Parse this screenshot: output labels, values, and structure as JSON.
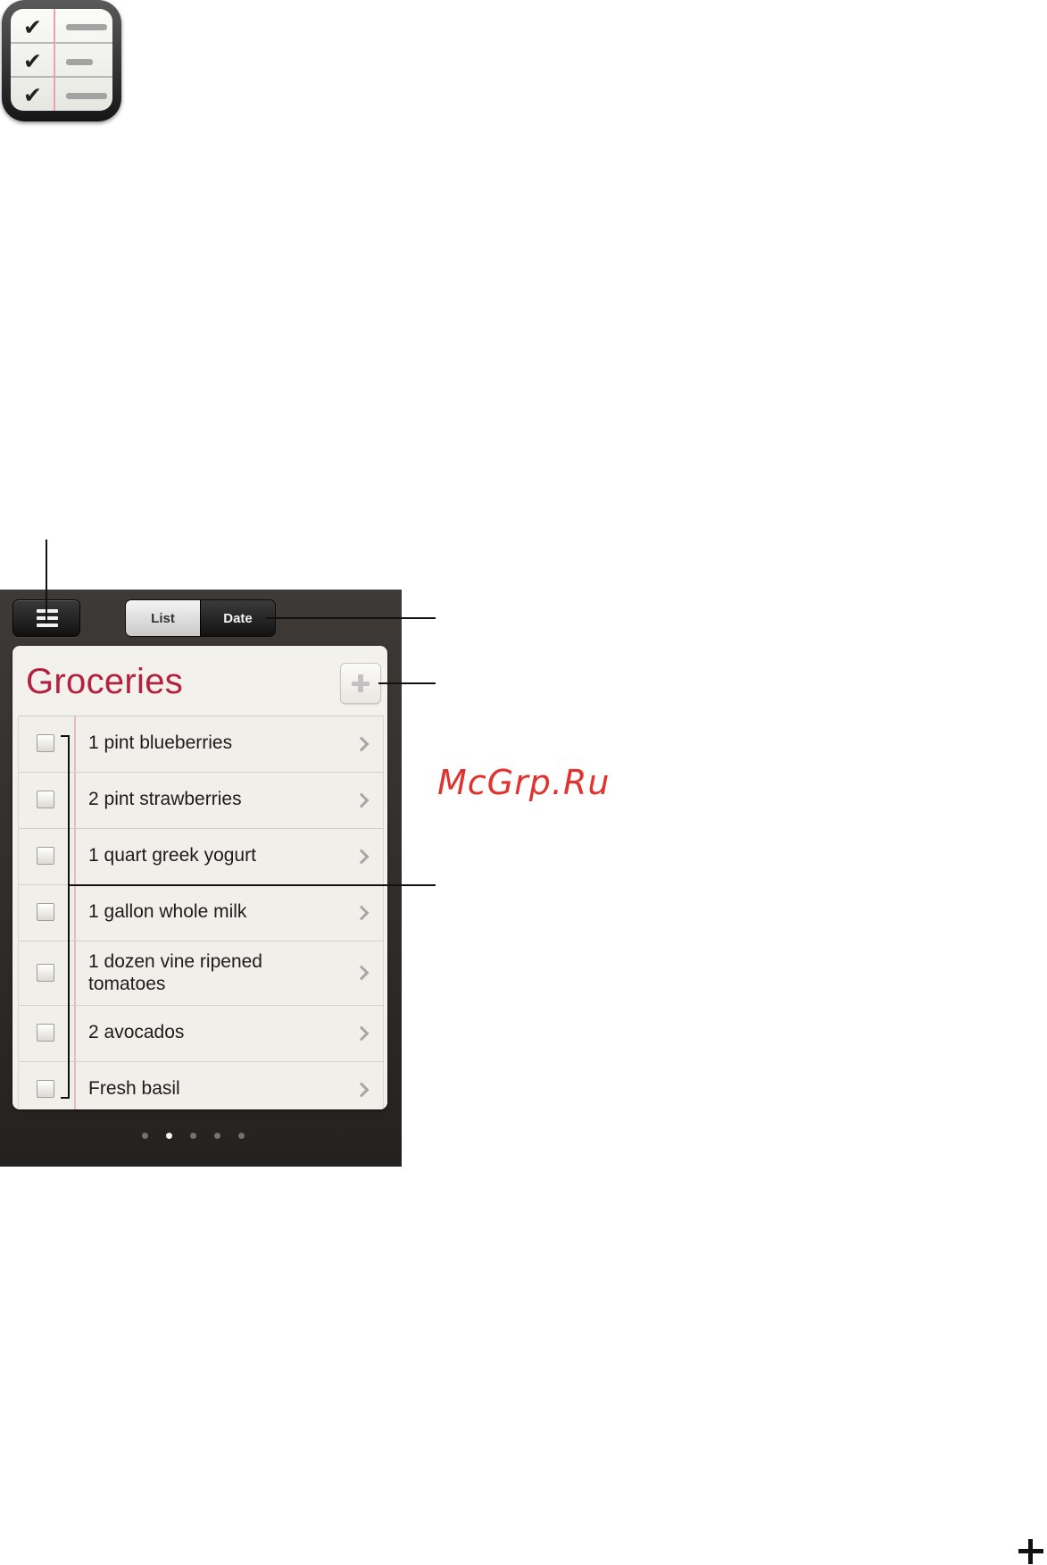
{
  "icon": {
    "name": "reminders-app-icon"
  },
  "toolbar": {
    "menu_icon": "list-menu-icon",
    "segments": [
      {
        "label": "List",
        "selected": true
      },
      {
        "label": "Date",
        "selected": false
      }
    ]
  },
  "list": {
    "title": "Groceries",
    "add_icon": "plus-icon",
    "items": [
      {
        "text": "1 pint blueberries",
        "checked": false
      },
      {
        "text": "2 pint strawberries",
        "checked": false
      },
      {
        "text": "1 quart greek yogurt",
        "checked": false
      },
      {
        "text": "1 gallon whole milk",
        "checked": false
      },
      {
        "text": "1 dozen vine ripened tomatoes",
        "checked": false
      },
      {
        "text": "2 avocados",
        "checked": false
      },
      {
        "text": "Fresh basil",
        "checked": false
      }
    ]
  },
  "pagination": {
    "count": 5,
    "current": 2
  },
  "watermark": {
    "text": "McGrp.Ru"
  },
  "colors": {
    "title_red": "#b4203f",
    "watermark_red": "#e2322d",
    "margin_pink": "#eab7c4"
  }
}
